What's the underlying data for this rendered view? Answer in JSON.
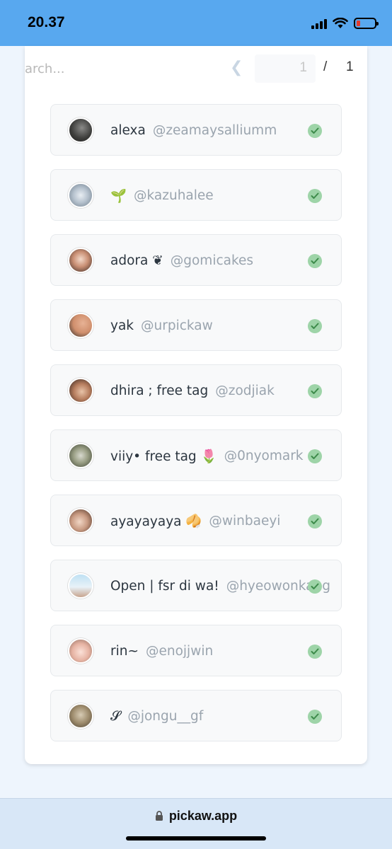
{
  "status_bar": {
    "time": "20.37"
  },
  "toolbar": {
    "search_placeholder": "arch...",
    "prev_icon": "chevron-left-icon",
    "current_page": "1",
    "separator": "/",
    "total_pages": "1"
  },
  "entries": [
    {
      "name": "alexa",
      "handle": "@zeamaysalliumm"
    },
    {
      "name": "🌱",
      "handle": "@kazuhalee"
    },
    {
      "name": "adora ❦",
      "handle": "@gomicakes"
    },
    {
      "name": "yak",
      "handle": "@urpickaw"
    },
    {
      "name": "dhira ; free tag",
      "handle": "@zodjiak"
    },
    {
      "name": "viiy• free tag 🌷",
      "handle": "@0nyomark"
    },
    {
      "name": "ayayayaya 🥠",
      "handle": "@winbaeyi"
    },
    {
      "name": "Open | fsr di wa!",
      "handle": "@hyeowonkang"
    },
    {
      "name": "rin~",
      "handle": "@enojjwin"
    },
    {
      "name": "𝓢",
      "handle": "@jongu__gf"
    }
  ],
  "browser": {
    "url": "pickaw.app"
  },
  "colors": {
    "status_bar_bg": "#58a8ef",
    "check_green": "#9ed4a8",
    "battery_low": "#e23b2f"
  }
}
